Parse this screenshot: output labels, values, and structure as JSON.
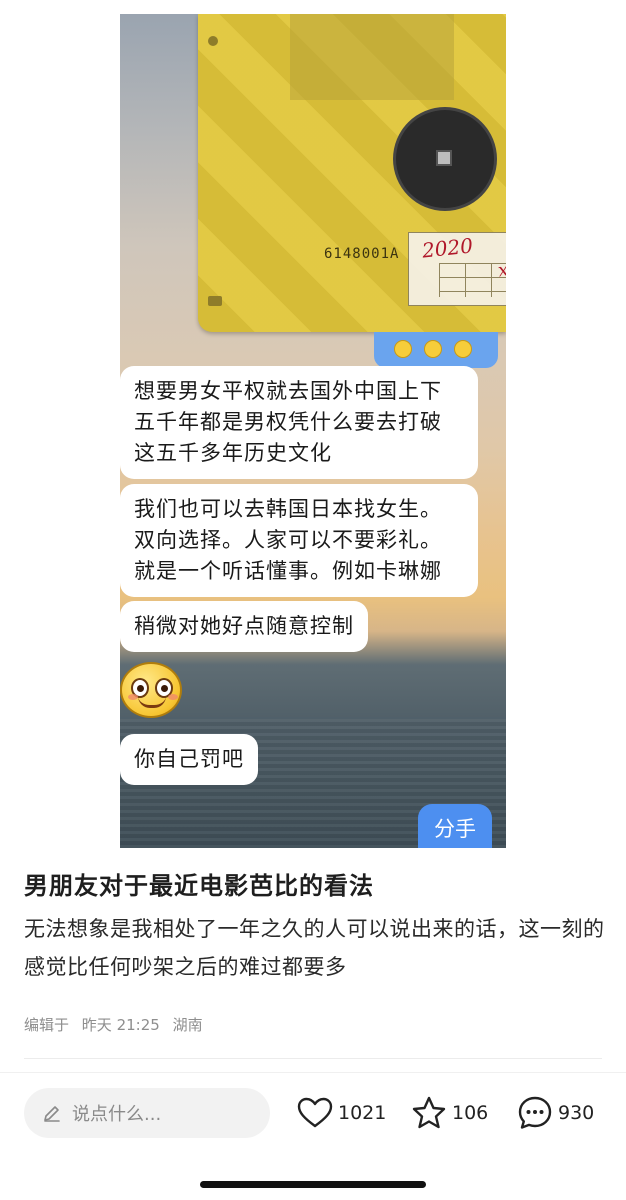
{
  "image": {
    "floppy_code": "6148001A",
    "floppy_scribble_1": "2020",
    "floppy_scribble_2": "xvv",
    "messages": [
      {
        "side": "left",
        "text": "想要男女平权就去国外中国上下\n五千年都是男权凭什么要去打破\n这五千多年历史文化"
      },
      {
        "side": "left",
        "text": "我们也可以去韩国日本找女生。\n双向选择。人家可以不要彩礼。\n就是一个听话懂事。例如卡琳娜"
      },
      {
        "side": "left",
        "text": "稍微对她好点随意控制"
      },
      {
        "side": "left",
        "text": "你自己罚吧"
      },
      {
        "side": "right",
        "text": "分手"
      }
    ]
  },
  "post": {
    "title": "男朋友对于最近电影芭比的看法",
    "body": "无法想象是我相处了一年之久的人可以说出来的话，这一刻的感觉比任何吵架之后的难过都要多",
    "meta_edited": "编辑于",
    "meta_time": "昨天 21:25",
    "meta_location": "湖南"
  },
  "actions": {
    "comment_placeholder": "说点什么...",
    "like_count": "1021",
    "collect_count": "106",
    "comment_count": "930"
  },
  "icons": {
    "comment_input": "pen-icon",
    "like": "heart-icon",
    "collect": "star-icon",
    "comment": "chat-bubble-icon"
  },
  "colors": {
    "bubble_right": "#4d8ff0",
    "floppy": "#e1c63a"
  }
}
